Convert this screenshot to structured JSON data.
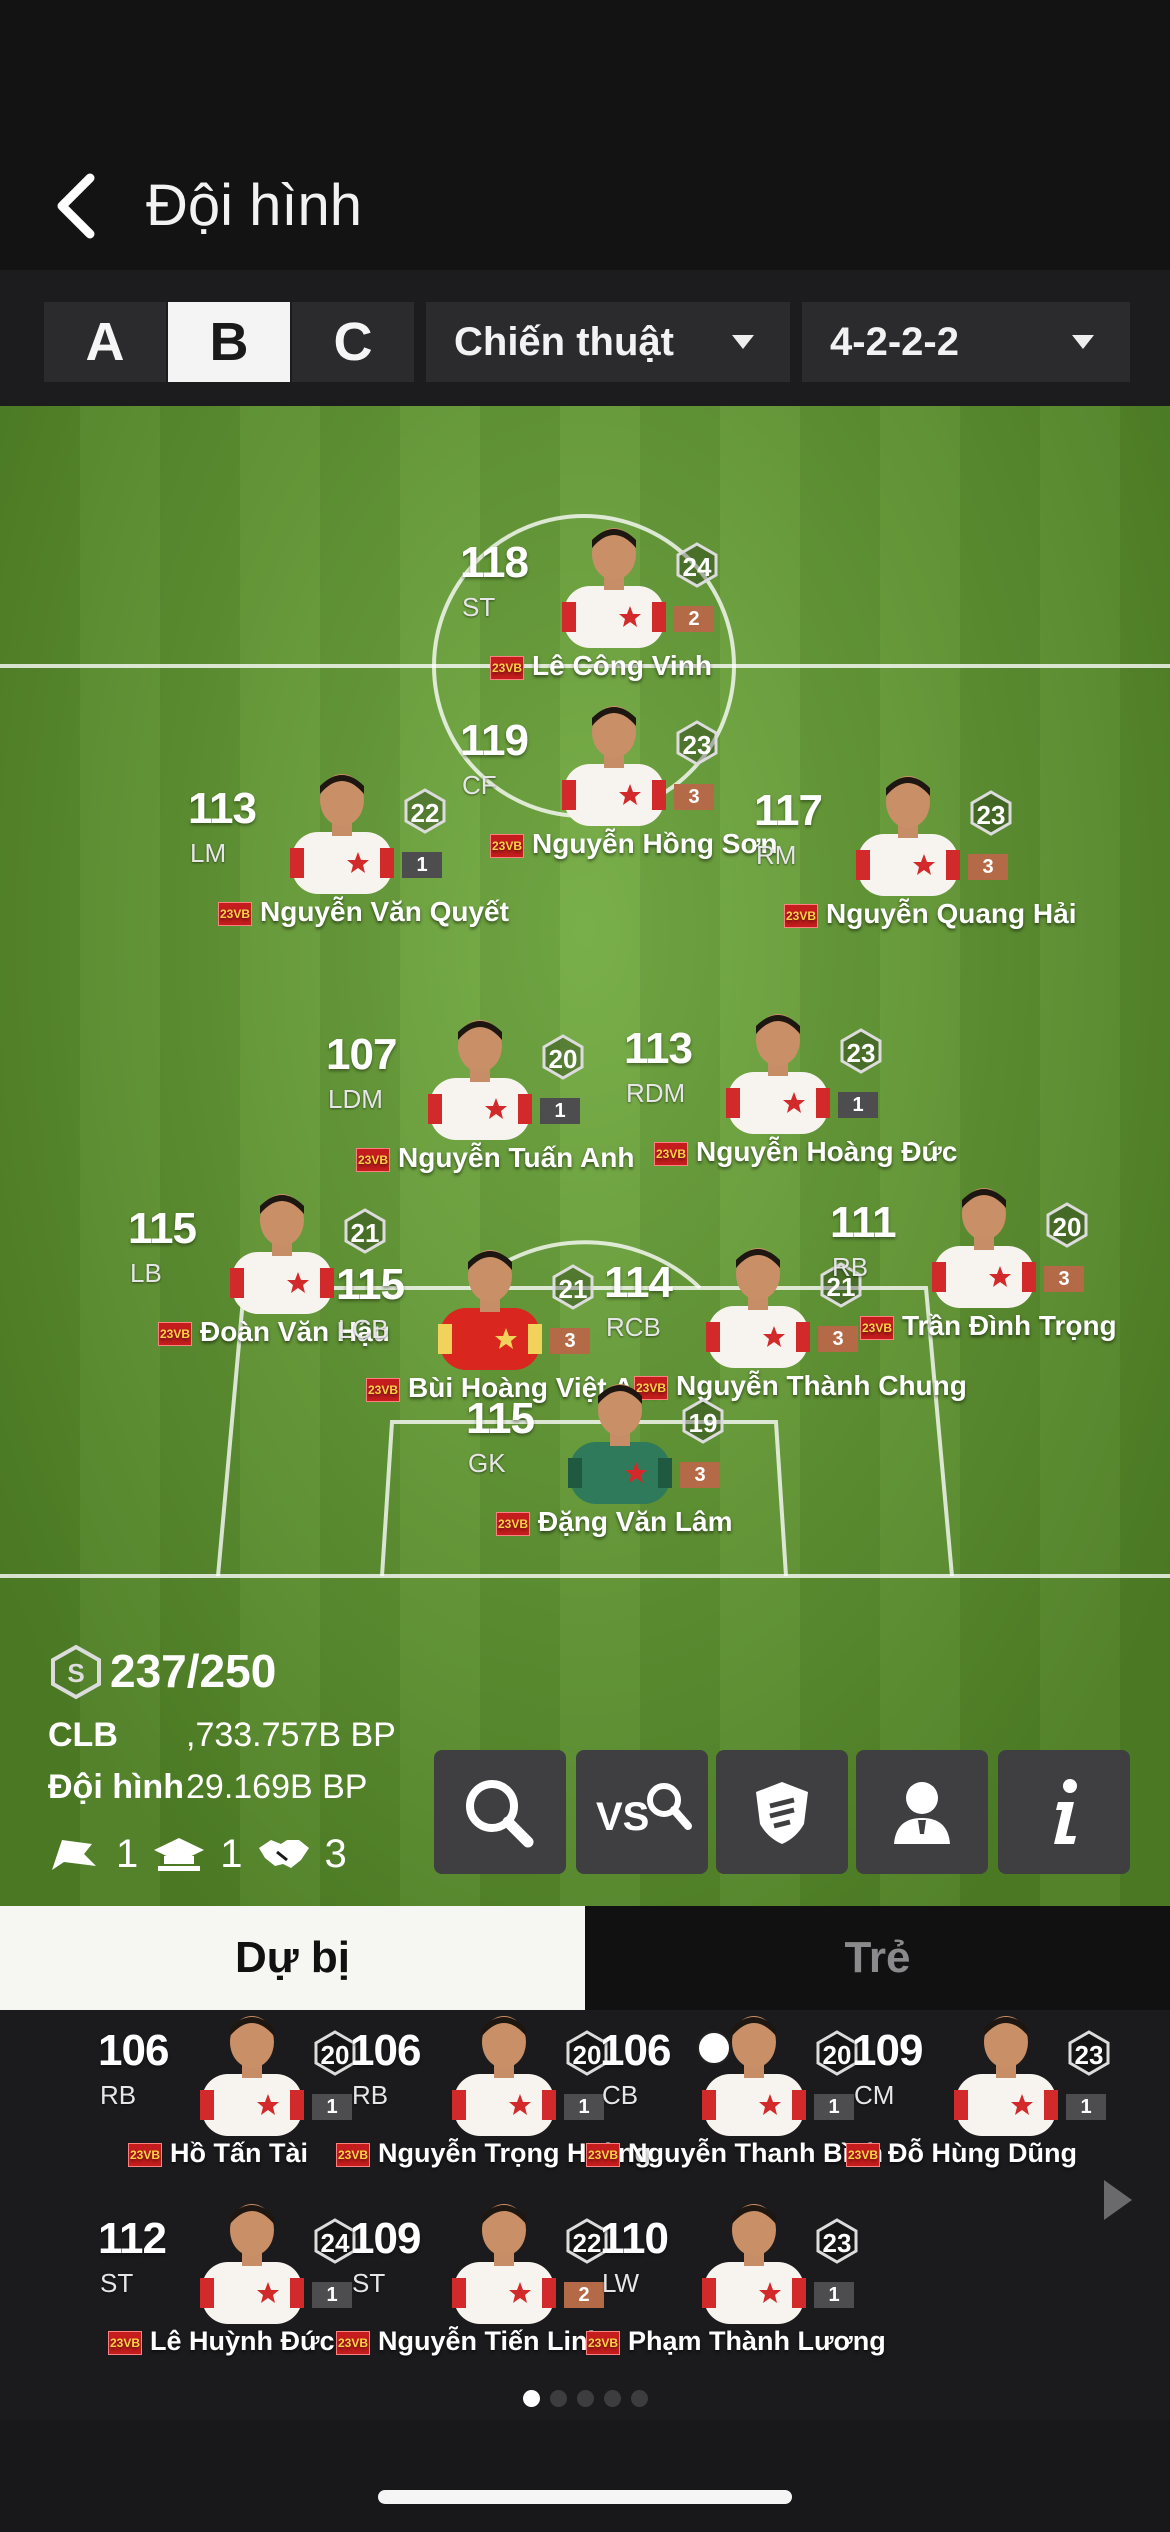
{
  "header": {
    "title": "Đội hình"
  },
  "squad_tabs": [
    {
      "label": "A",
      "active": false
    },
    {
      "label": "B",
      "active": true
    },
    {
      "label": "C",
      "active": false
    }
  ],
  "tactic_dropdown": {
    "value": "Chiến thuật"
  },
  "formation_dropdown": {
    "value": "4-2-2-2"
  },
  "season_tag": "23VB",
  "starters": [
    {
      "rating": "118",
      "position": "ST",
      "name": "Lê Công Vinh",
      "level": "24",
      "grade": "2",
      "grade_color": "bronze",
      "shirt": "white"
    },
    {
      "rating": "119",
      "position": "CF",
      "name": "Nguyễn Hồng Sơn",
      "level": "23",
      "grade": "3",
      "grade_color": "bronze",
      "shirt": "white"
    },
    {
      "rating": "113",
      "position": "LM",
      "name": "Nguyễn Văn Quyết",
      "level": "22",
      "grade": "1",
      "grade_color": "grey",
      "shirt": "white"
    },
    {
      "rating": "117",
      "position": "RM",
      "name": "Nguyễn Quang Hải",
      "level": "23",
      "grade": "3",
      "grade_color": "bronze",
      "shirt": "white"
    },
    {
      "rating": "107",
      "position": "LDM",
      "name": "Nguyễn Tuấn Anh",
      "level": "20",
      "grade": "1",
      "grade_color": "grey",
      "shirt": "white"
    },
    {
      "rating": "113",
      "position": "RDM",
      "name": "Nguyễn Hoàng Đức",
      "level": "23",
      "grade": "1",
      "grade_color": "grey",
      "shirt": "white"
    },
    {
      "rating": "115",
      "position": "LB",
      "name": "Đoàn Văn Hậu",
      "level": "21",
      "grade": "",
      "grade_color": "bronze",
      "shirt": "white"
    },
    {
      "rating": "115",
      "position": "LCB",
      "name": "Bùi Hoàng Việt Anh",
      "level": "21",
      "grade": "3",
      "grade_color": "bronze",
      "shirt": "red"
    },
    {
      "rating": "114",
      "position": "RCB",
      "name": "Nguyễn Thành Chung",
      "level": "21",
      "grade": "3",
      "grade_color": "bronze",
      "shirt": "white"
    },
    {
      "rating": "111",
      "position": "RB",
      "name": "Trần Đình Trọng",
      "level": "20",
      "grade": "3",
      "grade_color": "bronze",
      "shirt": "white"
    },
    {
      "rating": "115",
      "position": "GK",
      "name": "Đặng Văn Lâm",
      "level": "19",
      "grade": "3",
      "grade_color": "bronze",
      "shirt": "green"
    }
  ],
  "team_stats": {
    "salary": "237/250",
    "clb_label": "CLB",
    "clb_value": ",733.757B BP",
    "squad_label": "Đội hình",
    "squad_value": "29.169B BP",
    "chem_flag_count": "1",
    "chem_cap_count": "1",
    "chem_handshake_count": "3"
  },
  "actions": [
    {
      "icon": "search-icon"
    },
    {
      "icon": "vs-compare-icon"
    },
    {
      "icon": "shield-icon"
    },
    {
      "icon": "coach-icon"
    },
    {
      "icon": "info-icon"
    }
  ],
  "bench_tabs": {
    "reserves": "Dự bị",
    "youth": "Trẻ"
  },
  "bench": [
    {
      "rating": "106",
      "position": "RB",
      "name": "Hồ Tấn Tài",
      "level": "20",
      "grade": "1",
      "grade_color": "grey",
      "shirt": "white"
    },
    {
      "rating": "106",
      "position": "RB",
      "name": "Nguyễn Trọng Hoàng",
      "level": "20",
      "grade": "1",
      "grade_color": "grey",
      "shirt": "white"
    },
    {
      "rating": "106",
      "position": "CB",
      "name": "Nguyễn Thanh Bình",
      "level": "20",
      "grade": "1",
      "grade_color": "grey",
      "shirt": "white"
    },
    {
      "rating": "109",
      "position": "CM",
      "name": "Đỗ Hùng Dũng",
      "level": "23",
      "grade": "1",
      "grade_color": "grey",
      "shirt": "white"
    },
    {
      "rating": "112",
      "position": "ST",
      "name": "Lê Huỳnh Đức",
      "level": "24",
      "grade": "1",
      "grade_color": "grey",
      "shirt": "white"
    },
    {
      "rating": "109",
      "position": "ST",
      "name": "Nguyễn Tiến Linh",
      "level": "22",
      "grade": "2",
      "grade_color": "bronze",
      "shirt": "white"
    },
    {
      "rating": "110",
      "position": "LW",
      "name": "Phạm Thành Lương",
      "level": "23",
      "grade": "1",
      "grade_color": "grey",
      "shirt": "white"
    }
  ],
  "pager": {
    "pages": 5,
    "current": 0
  },
  "colors": {
    "pitch_light": "#6aa636",
    "pitch_dark": "#5f9a2d",
    "grade_bronze": "#b46a47",
    "grade_grey": "#4d4d50",
    "season_tag_red": "#c51d1d"
  }
}
